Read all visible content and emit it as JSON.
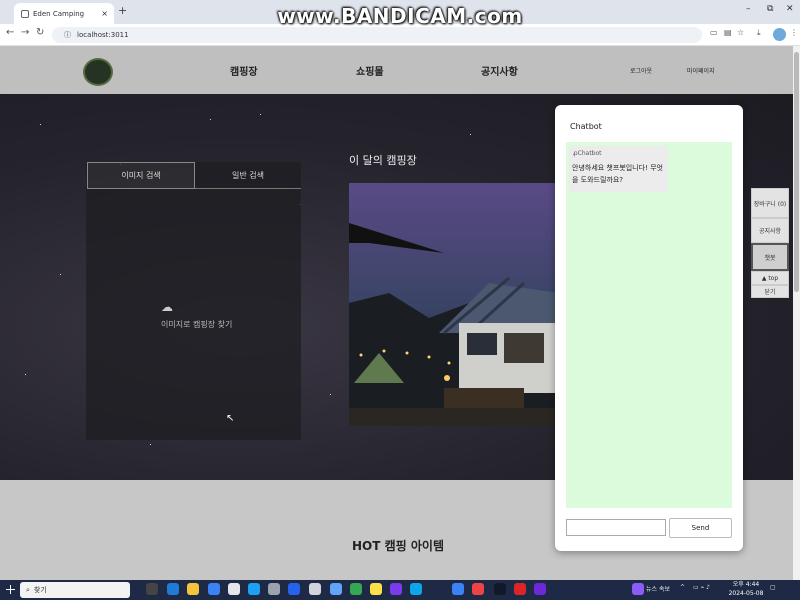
{
  "browser": {
    "tab_title": "Eden Camping",
    "tab_close": "×",
    "new_tab": "+",
    "url": "localhost:3011",
    "window_controls": [
      "–",
      "⧉",
      "✕"
    ]
  },
  "watermark": "www.BANDICAM.com",
  "site": {
    "nav": [
      "캠핑장",
      "쇼핑몰",
      "공지사항"
    ],
    "login": "로그아웃",
    "mypage": "마이페이지"
  },
  "search": {
    "tabs": [
      "이미지 검색",
      "일반 검색"
    ],
    "image_prompt": "이미지로 캠핑장 찾기"
  },
  "feature": {
    "title": "이 달의 캠핑장"
  },
  "hot": {
    "title": "HOT 캠핑 아이템"
  },
  "chatbot": {
    "title": "Chatbot",
    "sender": "Chatbot",
    "message": "안녕하세요 챗프봇입니다! 무엇을 도와드릴까요?",
    "input_value": "",
    "send_label": "Send"
  },
  "quick_menu": {
    "cart": "장바구니 (0)",
    "notice": "공지사항",
    "chatbot": "챗봇",
    "top": "▲ top",
    "close": "닫기"
  },
  "taskbar": {
    "search_placeholder": "찾기",
    "news": "뉴스 속보",
    "time": "오후 4:44",
    "date": "2024-05-08"
  }
}
